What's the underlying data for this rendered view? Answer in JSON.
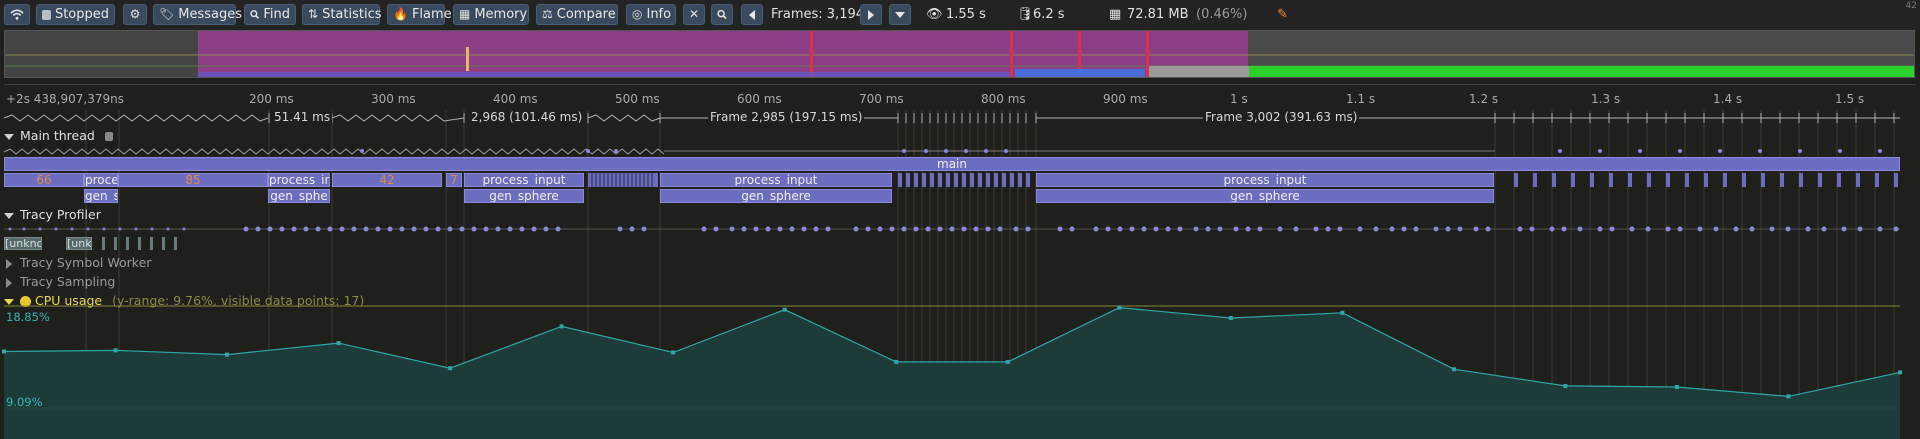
{
  "toolbar": {
    "status_label": "Stopped",
    "messages_label": "Messages",
    "find_label": "Find",
    "statistics_label": "Statistics",
    "flame_label": "Flame",
    "memory_label": "Memory",
    "compare_label": "Compare",
    "info_label": "Info",
    "frames_label": "Frames: 3,194",
    "view_time": "1.55 s",
    "total_time": "6.2 s",
    "memory_usage": "72.81 MB",
    "memory_percent": "(0.46%)",
    "corner_number": "42"
  },
  "ruler": {
    "start": "+2s 438,907,379ns",
    "ticks": [
      "200 ms",
      "300 ms",
      "400 ms",
      "500 ms",
      "600 ms",
      "700 ms",
      "800 ms",
      "900 ms",
      "1 s",
      "1.1 s",
      "1.2 s",
      "1.3 s",
      "1.4 s",
      "1.5 s"
    ]
  },
  "frames": [
    {
      "label": "51.41 ms"
    },
    {
      "label": "2,968 (101.46 ms)"
    },
    {
      "label": "Frame 2,985 (197.15 ms)"
    },
    {
      "label": "Frame 3,002 (391.63 ms)"
    }
  ],
  "threads": {
    "main_thread": "Main thread",
    "tracy_profiler": "Tracy Profiler",
    "symbol_worker": "Tracy Symbol Worker",
    "sampling": "Tracy Sampling",
    "cpu_usage": "CPU usage",
    "cpu_info": "(y-range: 9.76%, visible data points: 17)"
  },
  "zones": {
    "main": "main",
    "z66": "66",
    "proce": "proce",
    "z85": "85",
    "pin1": "process_in",
    "z42": "42",
    "z7": "7",
    "pin2": "process_input",
    "pin3": "process_input",
    "pin4": "process_input",
    "gs1": "gen_s",
    "gs2": "gen_sphe",
    "gs3": "gen_sphere",
    "gs4": "gen_sphere",
    "gs5": "gen_sphere",
    "unk1": "[unkno",
    "unk2": "[unk"
  },
  "cpu_chart": {
    "max_label": "18.85%",
    "min_label": "9.09%"
  },
  "chart_data": {
    "type": "area",
    "title": "CPU usage",
    "ylim": [
      9.09,
      18.85
    ],
    "values": [
      14.5,
      14.6,
      14.2,
      15.3,
      12.9,
      16.9,
      14.4,
      18.5,
      13.5,
      13.5,
      18.7,
      17.7,
      18.2,
      12.8,
      11.2,
      11.1,
      10.2,
      12.5
    ]
  },
  "colors": {
    "accent_button": "#3a4a5e",
    "zone": "#6c6cc0",
    "cpu_line": "#2fa7a7",
    "frame_marker": "#d9304d",
    "overview_green": "#2bd12b"
  }
}
